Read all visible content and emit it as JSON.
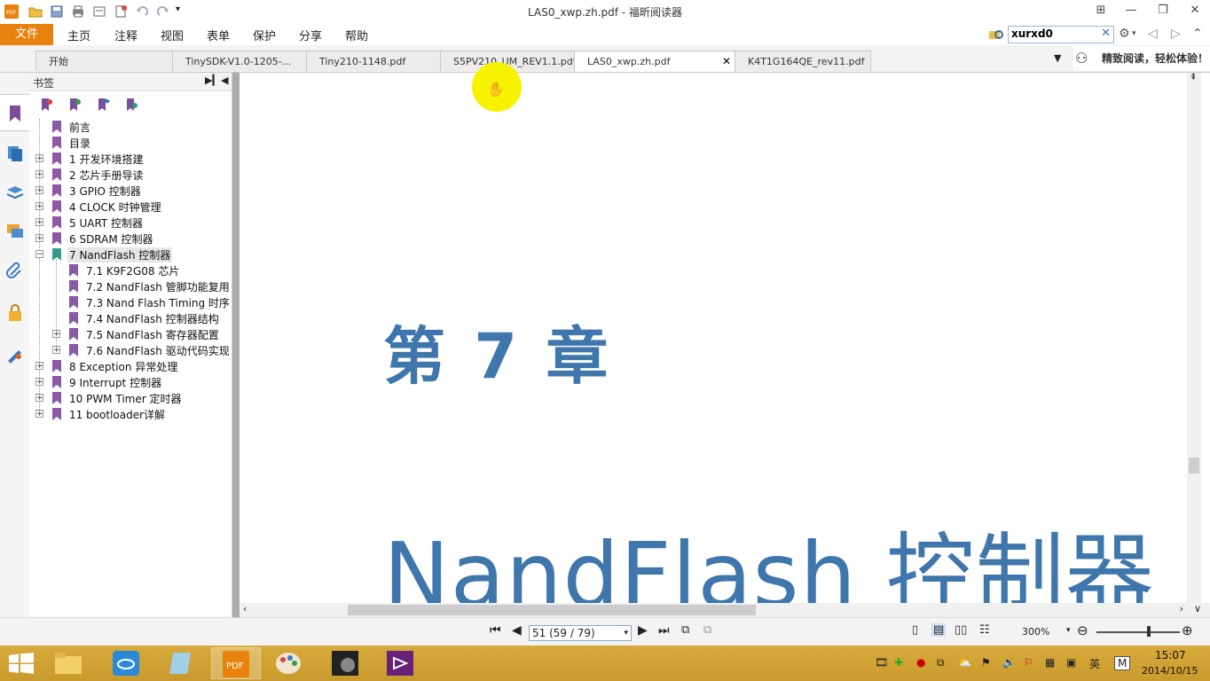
{
  "window": {
    "title": "LAS0_xwp.zh.pdf - 福昕阅读器"
  },
  "menu": {
    "file": "文件",
    "items": [
      "主页",
      "注释",
      "视图",
      "表单",
      "保护",
      "分享",
      "帮助"
    ]
  },
  "search": {
    "value": "xurxd0"
  },
  "tabs": [
    {
      "label": "开始"
    },
    {
      "label": "TinySDK-V1.0-1205-..."
    },
    {
      "label": "Tiny210-1148.pdf"
    },
    {
      "label": "S5PV210_UM_REV1.1.pdf"
    },
    {
      "label": "LAS0_xwp.zh.pdf"
    },
    {
      "label": "K4T1G164QE_rev11.pdf"
    }
  ],
  "promo": "精致阅读，轻松体验！",
  "bookmarks": {
    "header": "书签",
    "items": [
      {
        "label": "前言"
      },
      {
        "label": "目录"
      },
      {
        "label": "1 开发环境搭建"
      },
      {
        "label": "2 芯片手册导读"
      },
      {
        "label": "3 GPIO 控制器"
      },
      {
        "label": "4 CLOCK 时钟管理"
      },
      {
        "label": "5 UART 控制器"
      },
      {
        "label": "6 SDRAM 控制器"
      },
      {
        "label": "7 NandFlash 控制器"
      },
      {
        "label": "7.1 K9F2G08 芯片"
      },
      {
        "label": "7.2 NandFlash 管脚功能复用"
      },
      {
        "label": "7.3 Nand Flash Timing 时序"
      },
      {
        "label": "7.4 NandFlash 控制器结构"
      },
      {
        "label": "7.5 NandFlash 寄存器配置"
      },
      {
        "label": "7.6 NandFlash 驱动代码实现"
      },
      {
        "label": "8 Exception 异常处理"
      },
      {
        "label": "9 Interrupt 控制器"
      },
      {
        "label": "10 PWM Timer 定时器"
      },
      {
        "label": "11 bootloader详解"
      }
    ]
  },
  "document": {
    "chapter_number": "第 7 章",
    "chapter_title": "NandFlash 控制器"
  },
  "status": {
    "page": "51 (59 / 79)",
    "zoom": "300%"
  },
  "taskbar": {
    "time": "15:07",
    "date": "2014/10/15",
    "ime": "英",
    "ime2": "M"
  },
  "colors": {
    "accent": "#e8820c",
    "heading": "#3f77ad",
    "taskbar": "#d0a135"
  }
}
